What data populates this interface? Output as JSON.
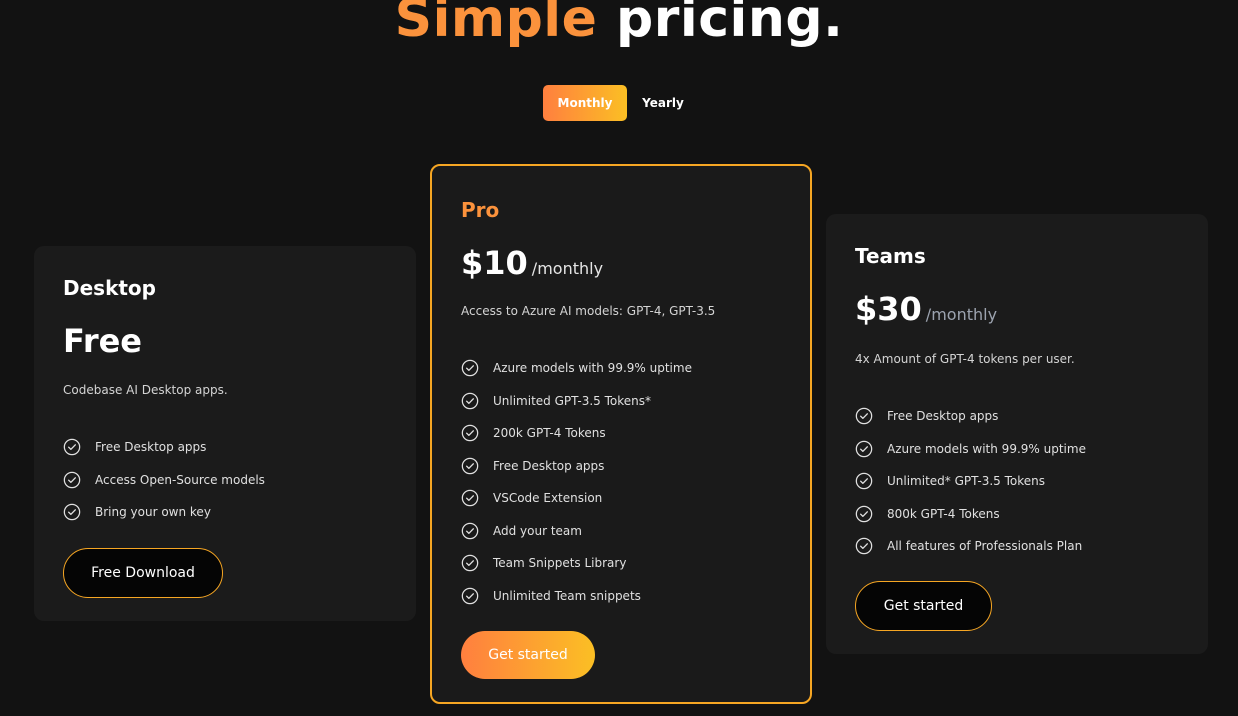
{
  "heading": {
    "accent": "Simple",
    "rest": " pricing."
  },
  "toggle": {
    "monthly": "Monthly",
    "yearly": "Yearly",
    "selected": "Monthly"
  },
  "plans": {
    "desktop": {
      "name": "Desktop",
      "price": "Free",
      "period": "",
      "description": "Codebase AI Desktop apps.",
      "features": [
        "Free Desktop apps",
        "Access Open-Source models",
        "Bring your own key"
      ],
      "cta": "Free Download"
    },
    "pro": {
      "name": "Pro",
      "price": "$10",
      "period": "/monthly",
      "description": "Access to Azure AI models: GPT-4, GPT-3.5",
      "features": [
        "Azure models with 99.9% uptime",
        "Unlimited GPT-3.5 Tokens*",
        "200k GPT-4 Tokens",
        "Free Desktop apps",
        "VSCode Extension",
        "Add your team",
        "Team Snippets Library",
        "Unlimited Team snippets"
      ],
      "cta": "Get started"
    },
    "teams": {
      "name": "Teams",
      "price": "$30",
      "period": "/monthly",
      "description": "4x Amount of GPT-4 tokens per user.",
      "features": [
        "Free Desktop apps",
        "Azure models with 99.9% uptime",
        "Unlimited* GPT-3.5 Tokens",
        "800k GPT-4 Tokens",
        "All features of Professionals Plan"
      ],
      "cta": "Get started"
    }
  },
  "colors": {
    "background": "#121212",
    "card": "#1b1b1b",
    "accent": "#fb923c",
    "gradient_end": "#fbbf24",
    "border": "#f6a623"
  },
  "icons": {
    "feature": "check-circle-icon"
  }
}
